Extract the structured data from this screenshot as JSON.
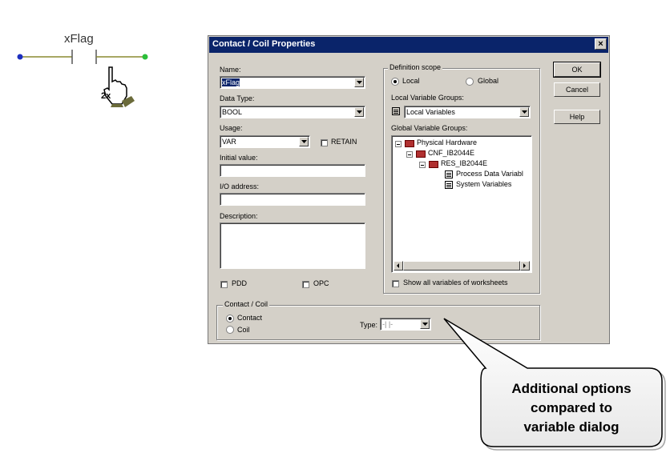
{
  "ladder": {
    "variable_label": "xFlag",
    "click_badge": "2x"
  },
  "dialog": {
    "title": "Contact / Coil Properties",
    "close_glyph": "×",
    "name": {
      "label": "Name:",
      "value": "xFlag"
    },
    "data_type": {
      "label": "Data Type:",
      "value": "BOOL"
    },
    "usage": {
      "label": "Usage:",
      "value": "VAR",
      "retain_label": "RETAIN"
    },
    "initial_value": {
      "label": "Initial value:",
      "value": ""
    },
    "io_address": {
      "label": "I/O address:",
      "value": ""
    },
    "description": {
      "label": "Description:",
      "value": ""
    },
    "pdd_label": "PDD",
    "opc_label": "OPC",
    "definition_scope": {
      "title": "Definition scope",
      "local_label": "Local",
      "global_label": "Global",
      "local_groups_label": "Local Variable Groups:",
      "local_groups_value": "Local Variables",
      "global_groups_label": "Global Variable Groups:",
      "tree": [
        "Physical Hardware",
        "CNF_IB2044E",
        "RES_IB2044E",
        "Process Data Variabl",
        "System Variables"
      ],
      "show_all_label": "Show all variables of worksheets"
    },
    "buttons": {
      "ok": "OK",
      "cancel": "Cancel",
      "help": "Help"
    },
    "contact_coil": {
      "title": "Contact / Coil",
      "contact_label": "Contact",
      "coil_label": "Coil",
      "type_label": "Type:",
      "type_value": "-| |-"
    }
  },
  "callout": {
    "line1": "Additional options",
    "line2": "compared to",
    "line3": "variable dialog"
  }
}
